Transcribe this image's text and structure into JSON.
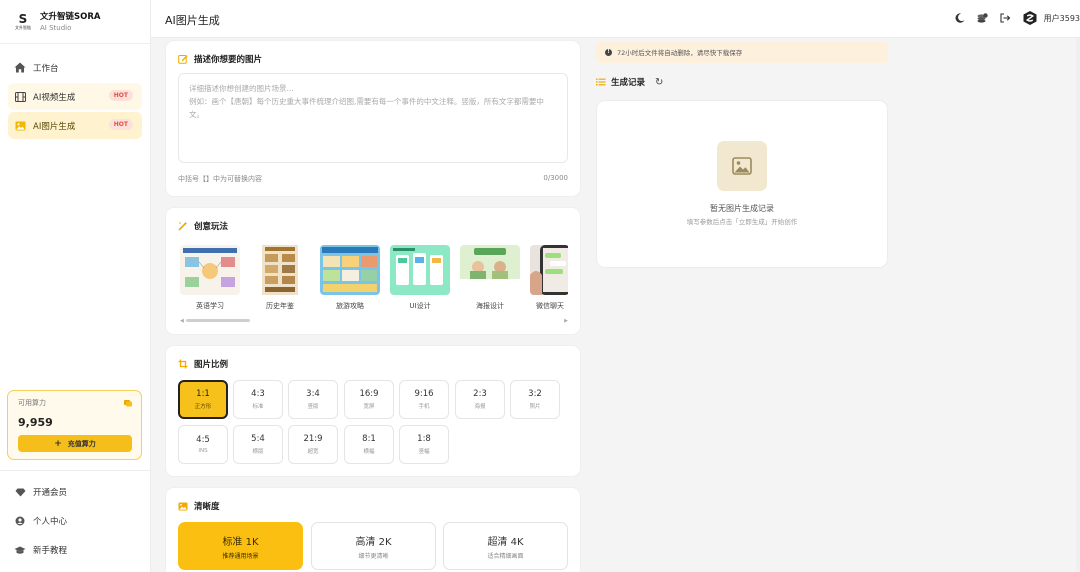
{
  "brand": {
    "name": "文升智链SORA",
    "subtitle": "AI Studio",
    "logo_mark": "S",
    "logo_mini": "文升智链"
  },
  "nav": {
    "items": [
      {
        "label": "工作台",
        "icon": "home-icon",
        "badge": ""
      },
      {
        "label": "AI视频生成",
        "icon": "film-icon",
        "badge": "HOT"
      },
      {
        "label": "AI图片生成",
        "icon": "image-icon",
        "badge": "HOT",
        "active": true
      }
    ],
    "bottom": [
      {
        "label": "开通会员",
        "icon": "diamond-icon"
      },
      {
        "label": "个人中心",
        "icon": "user-icon"
      },
      {
        "label": "新手教程",
        "icon": "graduation-cap-icon"
      }
    ]
  },
  "credits": {
    "label": "可用算力",
    "value": "9,959",
    "recharge_label": "充值算力",
    "recharge_prefix": "+"
  },
  "topbar": {
    "title": "AI图片生成",
    "user": "用户3593"
  },
  "prompt": {
    "heading": "描述你想要的图片",
    "placeholder": "详细描述你想创建的图片场景...\n例如：画个【唐朝】每个历史重大事件梳理介绍图,需要有每一个事件的中文注释。竖版，所有文字都需要中文。",
    "hint": "中括号【】中为可替换内容",
    "count": "0/3000"
  },
  "ideas": {
    "heading": "创意玩法",
    "items": [
      {
        "label": "英语学习"
      },
      {
        "label": "历史年鉴"
      },
      {
        "label": "旅游攻略"
      },
      {
        "label": "UI设计"
      },
      {
        "label": "海报设计"
      },
      {
        "label": "微信聊天"
      }
    ],
    "scroll_left": "◀",
    "scroll_right": "▶"
  },
  "ratio": {
    "heading": "图片比例",
    "options": [
      {
        "ratio": "1:1",
        "label": "正方形",
        "selected": true
      },
      {
        "ratio": "4:3",
        "label": "标准"
      },
      {
        "ratio": "3:4",
        "label": "竖版"
      },
      {
        "ratio": "16:9",
        "label": "宽屏"
      },
      {
        "ratio": "9:16",
        "label": "手机"
      },
      {
        "ratio": "2:3",
        "label": "海报"
      },
      {
        "ratio": "3:2",
        "label": "照片"
      },
      {
        "ratio": "4:5",
        "label": "INS"
      },
      {
        "ratio": "5:4",
        "label": "横版"
      },
      {
        "ratio": "21:9",
        "label": "超宽"
      },
      {
        "ratio": "8:1",
        "label": "横幅"
      },
      {
        "ratio": "1:8",
        "label": "竖幅"
      }
    ]
  },
  "quality": {
    "heading": "清晰度",
    "options": [
      {
        "title": "标准 1K",
        "desc": "推荐通用场景",
        "selected": true
      },
      {
        "title": "高清 2K",
        "desc": "细节更清晰"
      },
      {
        "title": "超清 4K",
        "desc": "适合精细画面"
      }
    ]
  },
  "notice": {
    "icon": "!",
    "text": "72小时后文件将自动删除，请尽快下载保存"
  },
  "history": {
    "heading": "生成记录",
    "refresh_icon": "↻",
    "empty_title": "暂无图片生成记录",
    "empty_desc": "填写参数后点击「立即生成」开始创作"
  },
  "colors": {
    "accent": "#f7c11b",
    "hot_bg": "#fde0dc",
    "hot_text": "#e0523f"
  }
}
